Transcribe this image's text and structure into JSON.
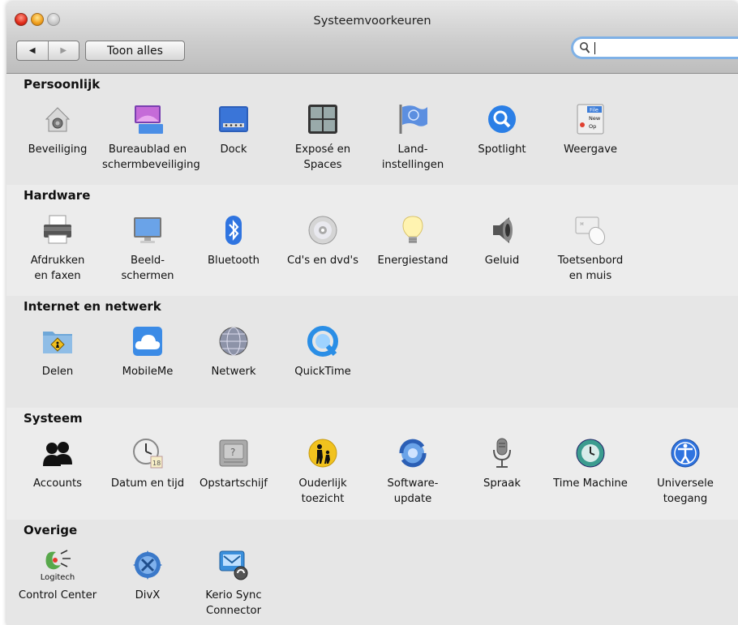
{
  "window": {
    "title": "Systeemvoorkeuren",
    "toolbar": {
      "back_label": "◀",
      "forward_label": "▶",
      "show_all_label": "Toon alles"
    },
    "search": {
      "value": "",
      "placeholder": ""
    }
  },
  "sections": [
    {
      "title": "Persoonlijk",
      "items": [
        {
          "label": "Beveiliging",
          "icon": "security-house-icon"
        },
        {
          "label": "Bureaublad en\nschermbeveiliging",
          "icon": "desktop-icon"
        },
        {
          "label": "Dock",
          "icon": "dock-icon"
        },
        {
          "label": "Exposé en\nSpaces",
          "icon": "expose-icon"
        },
        {
          "label": "Land-\ninstellingen",
          "icon": "flag-icon"
        },
        {
          "label": "Spotlight",
          "icon": "spotlight-icon"
        },
        {
          "label": "Weergave",
          "icon": "appearance-icon"
        }
      ]
    },
    {
      "title": "Hardware",
      "items": [
        {
          "label": "Afdrukken\nen faxen",
          "icon": "printer-icon"
        },
        {
          "label": "Beeld-\nschermen",
          "icon": "display-icon"
        },
        {
          "label": "Bluetooth",
          "icon": "bluetooth-icon"
        },
        {
          "label": "Cd's en dvd's",
          "icon": "cd-icon"
        },
        {
          "label": "Energiestand",
          "icon": "lightbulb-icon"
        },
        {
          "label": "Geluid",
          "icon": "speaker-icon"
        },
        {
          "label": "Toetsenbord\nen muis",
          "icon": "keyboard-mouse-icon"
        }
      ]
    },
    {
      "title": "Internet en netwerk",
      "items": [
        {
          "label": "Delen",
          "icon": "sharing-folder-icon"
        },
        {
          "label": "MobileMe",
          "icon": "cloud-icon"
        },
        {
          "label": "Netwerk",
          "icon": "globe-icon"
        },
        {
          "label": "QuickTime",
          "icon": "quicktime-icon"
        }
      ]
    },
    {
      "title": "Systeem",
      "items": [
        {
          "label": "Accounts",
          "icon": "accounts-icon"
        },
        {
          "label": "Datum en tijd",
          "icon": "clock-icon"
        },
        {
          "label": "Opstartschijf",
          "icon": "startup-disk-icon"
        },
        {
          "label": "Ouderlijk\ntoezicht",
          "icon": "parental-controls-icon"
        },
        {
          "label": "Software-\nupdate",
          "icon": "software-update-icon"
        },
        {
          "label": "Spraak",
          "icon": "microphone-icon"
        },
        {
          "label": "Time Machine",
          "icon": "time-machine-icon"
        },
        {
          "label": "Universele\ntoegang",
          "icon": "accessibility-icon"
        }
      ]
    },
    {
      "title": "Overige",
      "items": [
        {
          "label": "Control Center",
          "icon": "logitech-icon",
          "icon_text": "Logitech"
        },
        {
          "label": "DivX",
          "icon": "divx-icon"
        },
        {
          "label": "Kerio Sync\nConnector",
          "icon": "kerio-sync-icon"
        }
      ]
    }
  ]
}
